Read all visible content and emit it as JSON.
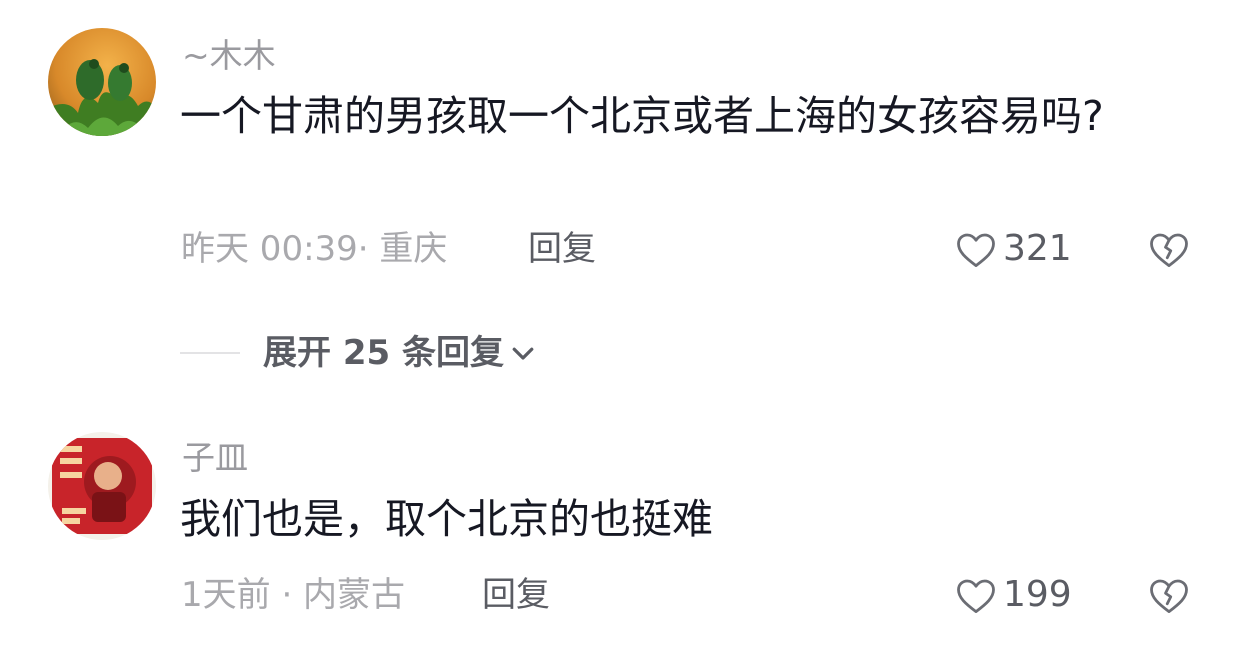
{
  "comments": [
    {
      "username": "~木木",
      "text": "一个甘肃的男孩取一个北京或者上海的女孩容易吗?",
      "meta": "昨天 00:39· 重庆",
      "reply_label": "回复",
      "like_count": "321"
    },
    {
      "username": "子皿",
      "text": "我们也是，取个北京的也挺难",
      "meta": "1天前 · 内蒙古",
      "reply_label": "回复",
      "like_count": "199"
    }
  ],
  "expand_replies": {
    "label": "展开 25 条回复"
  },
  "icons": {
    "like": "heart-outline-icon",
    "dislike": "broken-heart-icon",
    "expand": "chevron-down-icon"
  },
  "colors": {
    "text_primary": "#161823",
    "text_secondary": "#a9a9ad",
    "action": "#5a5c63"
  }
}
